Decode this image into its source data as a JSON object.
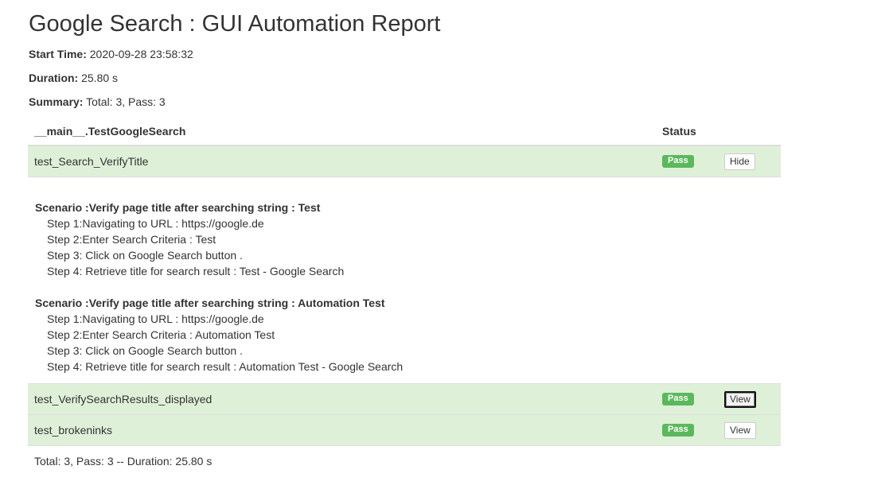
{
  "report": {
    "title": "Google Search : GUI Automation Report",
    "start_time_label": "Start Time:",
    "start_time": "2020-09-28 23:58:32",
    "duration_label": "Duration:",
    "duration": "25.80 s",
    "summary_label": "Summary:",
    "summary": "Total: 3, Pass: 3"
  },
  "table": {
    "header_class": "__main__.TestGoogleSearch",
    "header_status": "Status",
    "tests": [
      {
        "name": "test_Search_VerifyTitle",
        "status": "Pass",
        "button": "Hide"
      },
      {
        "name": "test_VerifySearchResults_displayed",
        "status": "Pass",
        "button": "View"
      },
      {
        "name": "test_brokeninks",
        "status": "Pass",
        "button": "View"
      }
    ],
    "detail": {
      "scenarios": [
        {
          "title": "Scenario :Verify page title after searching string : Test",
          "steps": [
            "Step 1:Navigating to URL : https://google.de",
            "Step 2:Enter Search Criteria : Test",
            "Step 3: Click on Google Search button .",
            "Step 4: Retrieve title for search result : Test - Google Search"
          ]
        },
        {
          "title": "Scenario :Verify page title after searching string : Automation Test",
          "steps": [
            "Step 1:Navigating to URL : https://google.de",
            "Step 2:Enter Search Criteria : Automation Test",
            "Step 3: Click on Google Search button .",
            "Step 4: Retrieve title for search result : Automation Test - Google Search"
          ]
        }
      ]
    },
    "footer": "Total: 3, Pass: 3 -- Duration: 25.80 s"
  },
  "colors": {
    "pass_row_bg": "#dff0d8",
    "pass_label_bg": "#5cb85c"
  }
}
